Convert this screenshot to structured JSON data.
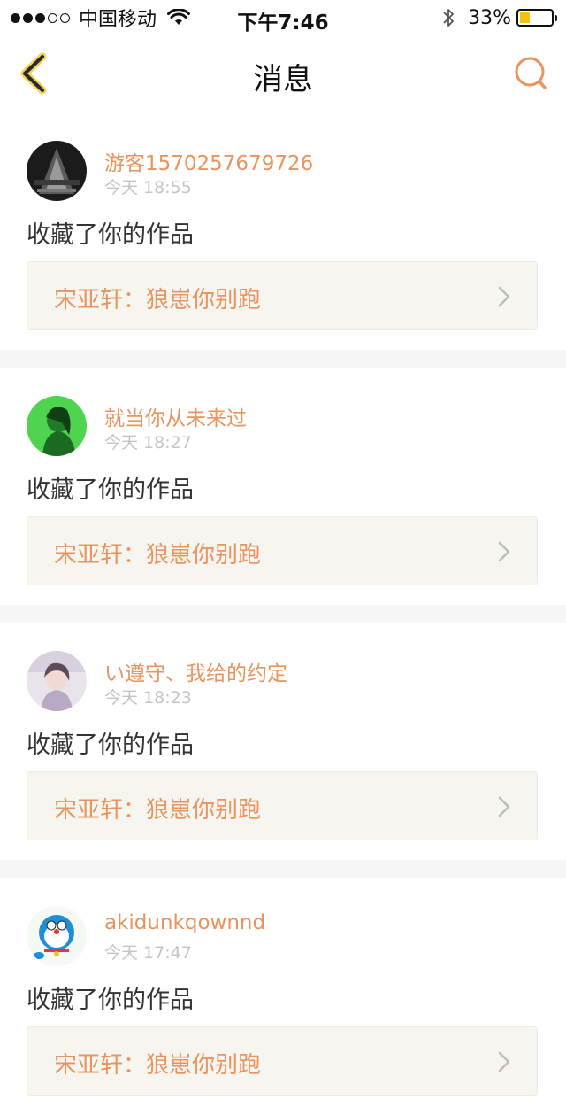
{
  "status_bar": {
    "carrier": "中国移动",
    "time": "下午7:46",
    "battery_percent_text": "33%",
    "battery_level": 0.33,
    "signal_bars_filled": 3,
    "signal_bars_total": 5
  },
  "header": {
    "title": "消息",
    "back_icon": "chevron-left-icon",
    "search_icon": "search-icon",
    "accent_color": "#e9935e"
  },
  "messages": [
    {
      "username": "游客1570257679726",
      "time": "今天 18:55",
      "action": "收藏了你的作品",
      "work": "宋亚轩：狼崽你别跑"
    },
    {
      "username": "就当你从未来过",
      "time": "今天 18:27",
      "action": "收藏了你的作品",
      "work": "宋亚轩：狼崽你别跑"
    },
    {
      "username": "い遵守、我给的约定",
      "time": "今天 18:23",
      "action": "收藏了你的作品",
      "work": "宋亚轩：狼崽你别跑"
    },
    {
      "username": "akidunkqownnd",
      "time": "今天 17:47",
      "action": "收藏了你的作品",
      "work": "宋亚轩：狼崽你别跑"
    }
  ]
}
